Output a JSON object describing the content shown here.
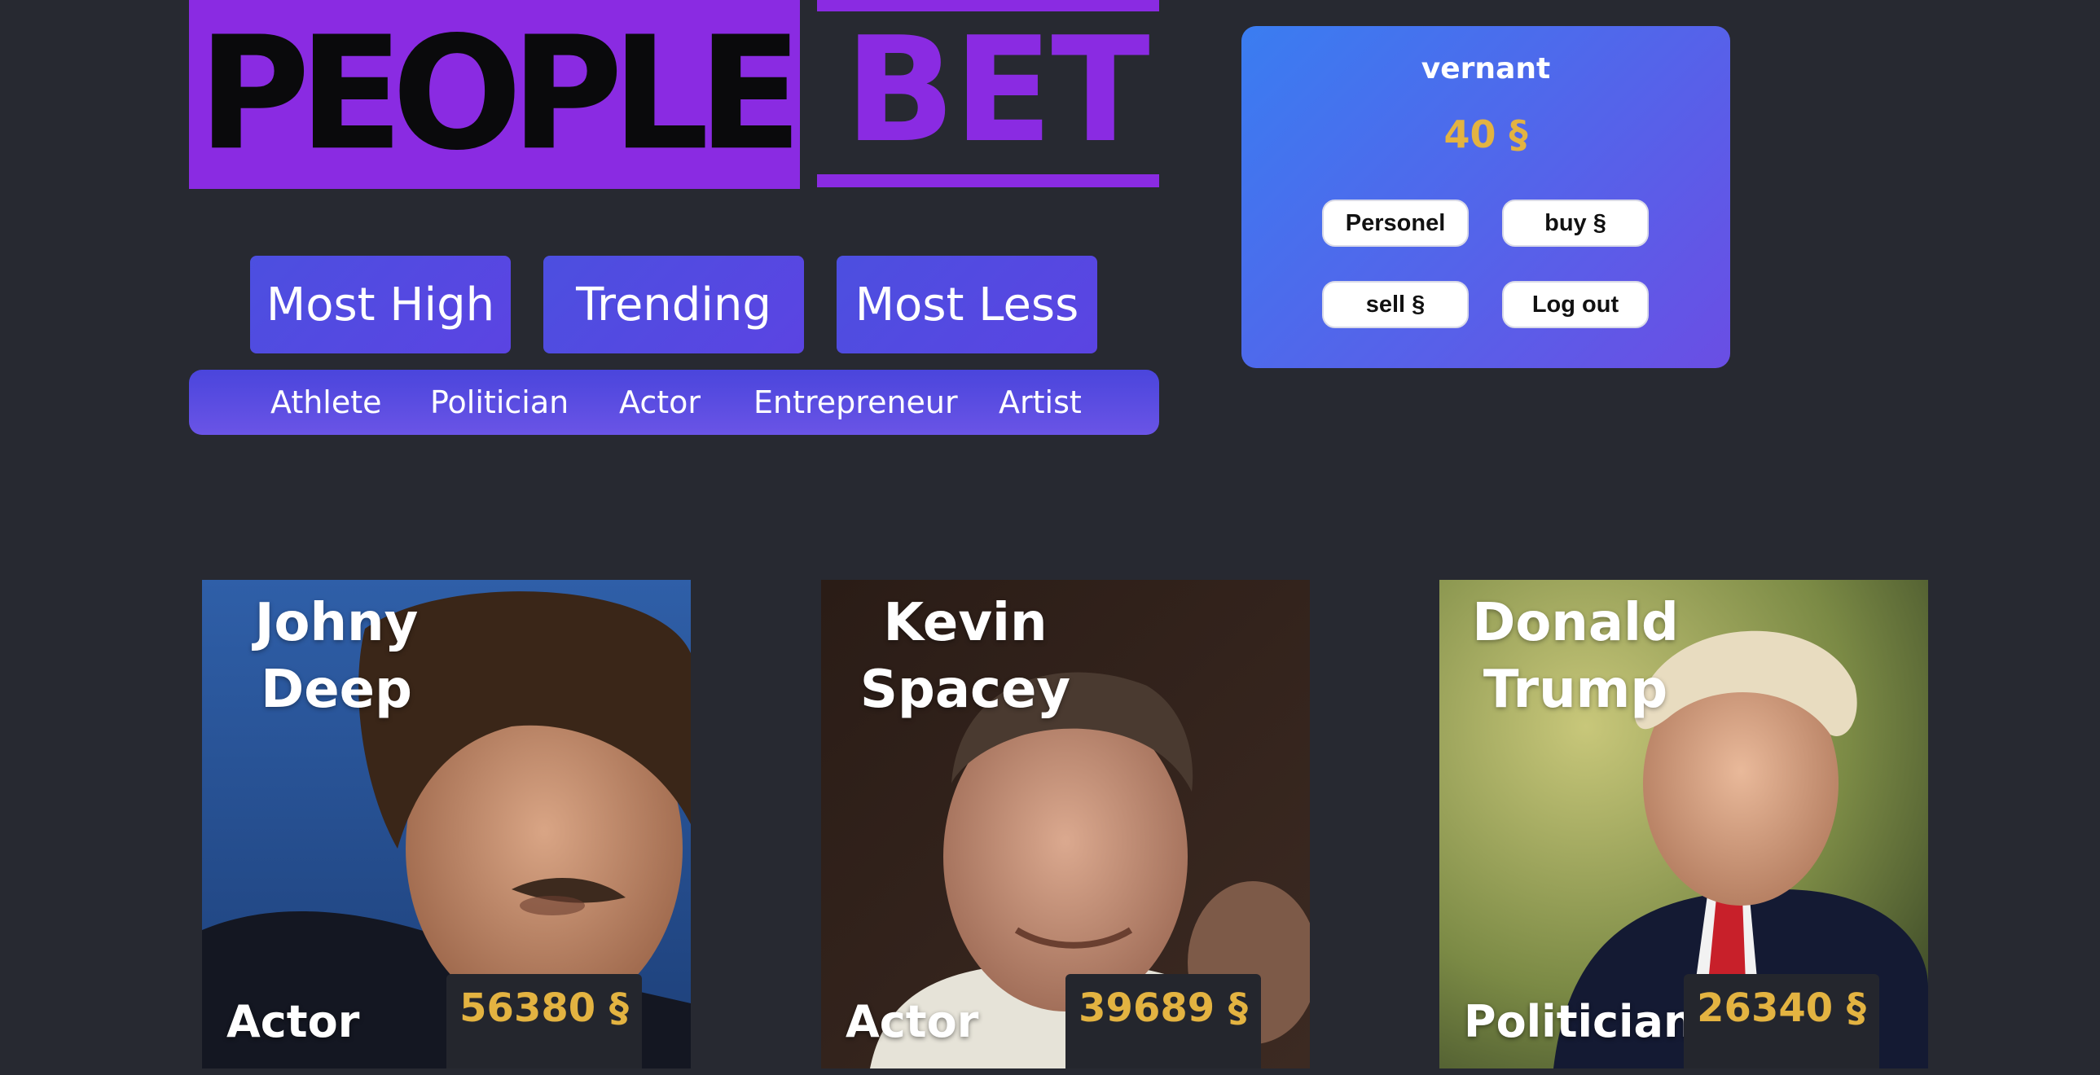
{
  "logo": {
    "left": "PEOPLE",
    "right": "BET",
    "color": "#8a2be2"
  },
  "sort_buttons": [
    {
      "label": "Most High"
    },
    {
      "label": "Trending"
    },
    {
      "label": "Most Less"
    }
  ],
  "categories": [
    "Athlete",
    "Politician",
    "Actor",
    "Entrepreneur",
    "Artist"
  ],
  "user": {
    "name": "vernant",
    "balance": "40 §",
    "buttons": {
      "personel": "Personel",
      "buy": "buy §",
      "sell": "sell §",
      "logout": "Log out"
    }
  },
  "cards": [
    {
      "name_line1": "Johny",
      "name_line2": "Deep",
      "category": "Actor",
      "price": "56380 §"
    },
    {
      "name_line1": "Kevin",
      "name_line2": "Spacey",
      "category": "Actor",
      "price": "39689 §"
    },
    {
      "name_line1": "Donald",
      "name_line2": "Trump",
      "category": "Politician",
      "price": "26340 §"
    }
  ],
  "colors": {
    "background": "#272931",
    "accent": "#8a2be2",
    "price": "#e3b341",
    "button": "#4c4fe0"
  }
}
